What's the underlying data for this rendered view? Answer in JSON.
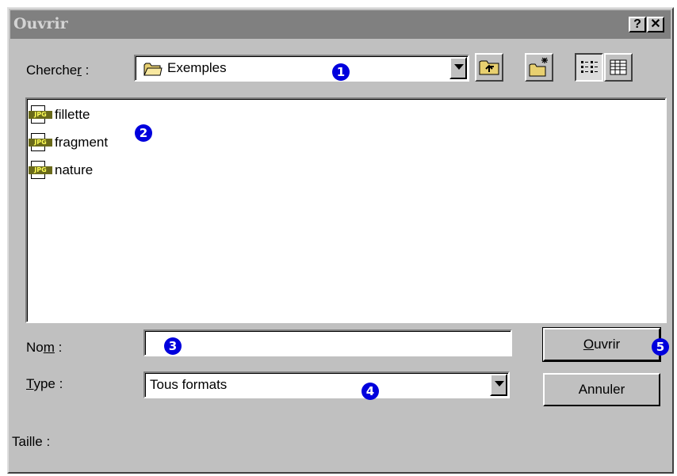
{
  "window": {
    "title": "Ouvrir",
    "help_label": "?",
    "close_label": "✕"
  },
  "lookin": {
    "label_pre": "Cherche",
    "label_acc": "r",
    "label_post": " :",
    "value": "Exemples"
  },
  "files": [
    {
      "name": "fillette",
      "badge": "JPG"
    },
    {
      "name": "fragment",
      "badge": "JPG"
    },
    {
      "name": "nature",
      "badge": "JPG"
    }
  ],
  "name_field": {
    "label_pre": "No",
    "label_acc": "m",
    "label_post": " :",
    "value": ""
  },
  "type_field": {
    "label_acc": "T",
    "label_post": "ype :",
    "value": "Tous formats"
  },
  "buttons": {
    "open_acc": "O",
    "open_rest": "uvrir",
    "cancel": "Annuler"
  },
  "size_label": "Taille :",
  "markers": [
    "1",
    "2",
    "3",
    "4",
    "5"
  ],
  "colors": {
    "marker": "#0000dd",
    "titlebar": "#808080",
    "face": "#c0c0c0"
  },
  "icons": [
    "folder-icon",
    "up-folder-icon",
    "new-folder-icon",
    "list-view-icon",
    "details-view-icon",
    "jpg-file-icon"
  ]
}
